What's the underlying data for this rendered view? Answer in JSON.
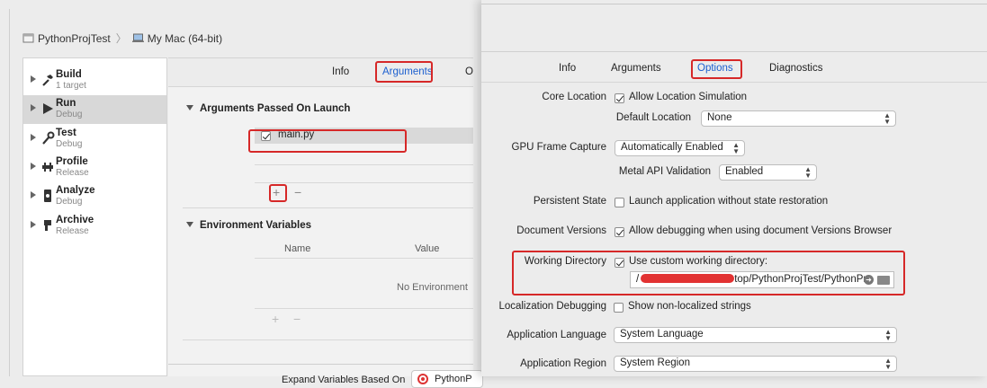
{
  "left_window": {
    "scheme": {
      "project": "PythonProjTest",
      "separator": "〉",
      "destination": "My Mac (64-bit)"
    },
    "sidebar": {
      "items": [
        {
          "title": "Build",
          "subtitle": "1 target",
          "icon": "hammer-icon"
        },
        {
          "title": "Run",
          "subtitle": "Debug",
          "icon": "play-icon"
        },
        {
          "title": "Test",
          "subtitle": "Debug",
          "icon": "wrench-icon"
        },
        {
          "title": "Profile",
          "subtitle": "Release",
          "icon": "gauge-icon"
        },
        {
          "title": "Analyze",
          "subtitle": "Debug",
          "icon": "analyze-icon"
        },
        {
          "title": "Archive",
          "subtitle": "Release",
          "icon": "archive-icon"
        }
      ],
      "selected": "Run"
    },
    "tabs": [
      {
        "label": "Info"
      },
      {
        "label": "Arguments"
      },
      {
        "label": "O"
      }
    ],
    "active_tab": "Arguments",
    "arguments_section": {
      "title": "Arguments Passed On Launch",
      "items": [
        {
          "label": "main.py",
          "checked": true
        }
      ],
      "add": "+",
      "remove": "−"
    },
    "env_section": {
      "title": "Environment Variables",
      "columns": [
        "Name",
        "Value"
      ],
      "empty_text": "No Environment",
      "add": "+",
      "remove": "−"
    },
    "expand_variables": {
      "label": "Expand Variables Based On",
      "value": "PythonP"
    }
  },
  "right_window": {
    "tabs": [
      {
        "label": "Info"
      },
      {
        "label": "Arguments"
      },
      {
        "label": "Options"
      },
      {
        "label": "Diagnostics"
      }
    ],
    "active_tab": "Options",
    "core_location": {
      "label": "Core Location",
      "checkbox_label": "Allow Location Simulation",
      "checked": true,
      "default_label": "Default Location",
      "default_value": "None"
    },
    "gpu_frame_capture": {
      "label": "GPU Frame Capture",
      "value": "Automatically Enabled",
      "metal_label": "Metal API Validation",
      "metal_value": "Enabled"
    },
    "persistent_state": {
      "label": "Persistent State",
      "checkbox_label": "Launch application without state restoration",
      "checked": false
    },
    "document_versions": {
      "label": "Document Versions",
      "checkbox_label": "Allow debugging when using document Versions Browser",
      "checked": true
    },
    "working_directory": {
      "label": "Working Directory",
      "checkbox_label": "Use custom working directory:",
      "checked": true,
      "path_prefix": "/",
      "path_suffix": "top/PythonProjTest/PythonPro"
    },
    "localization_debugging": {
      "label": "Localization Debugging",
      "checkbox_label": "Show non-localized strings",
      "checked": false
    },
    "application_language": {
      "label": "Application Language",
      "value": "System Language"
    },
    "application_region": {
      "label": "Application Region",
      "value": "System Region"
    }
  },
  "colors": {
    "highlight_red": "#d62828",
    "active_tab_blue": "#1b5fcf",
    "redaction": "#e23232"
  }
}
